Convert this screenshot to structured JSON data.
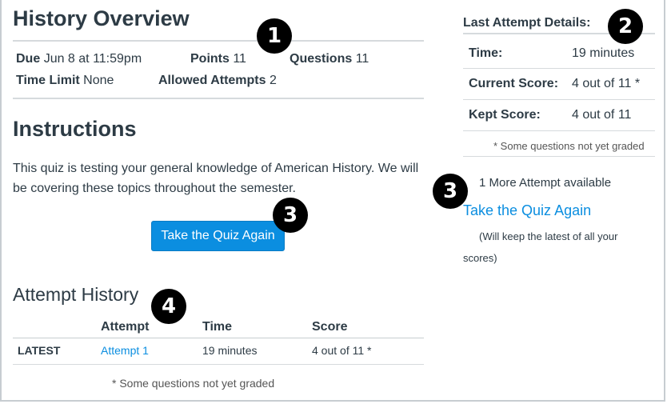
{
  "overview": {
    "title": "History Overview",
    "due_label": "Due",
    "due_value": "Jun 8 at 11:59pm",
    "points_label": "Points",
    "points_value": "11",
    "questions_label": "Questions",
    "questions_value": "11",
    "time_limit_label": "Time Limit",
    "time_limit_value": "None",
    "allowed_attempts_label": "Allowed Attempts",
    "allowed_attempts_value": "2"
  },
  "instructions": {
    "title": "Instructions",
    "text": "This quiz is testing your general knowledge of American History. We will be covering these topics throughout the semester.",
    "button_label": "Take the Quiz Again"
  },
  "attempt_history": {
    "title": "Attempt History",
    "columns": [
      "Attempt",
      "Time",
      "Score"
    ],
    "rows": [
      {
        "tag": "LATEST",
        "attempt": "Attempt 1",
        "time": "19 minutes",
        "score": "4 out of 11 *"
      }
    ],
    "footnote": "* Some questions not yet graded"
  },
  "sidebar": {
    "title": "Last Attempt Details:",
    "rows": [
      {
        "label": "Time:",
        "value": "19 minutes"
      },
      {
        "label": "Current Score:",
        "value": "4 out of 11 *"
      },
      {
        "label": "Kept Score:",
        "value": "4 out of 11"
      }
    ],
    "footnote": "* Some questions not yet graded",
    "more_attempts": "1 More Attempt available",
    "retake_link": "Take the Quiz Again",
    "keep_note": "(Will keep the latest of all your scores)"
  },
  "badges": [
    "1",
    "2",
    "3",
    "3",
    "4"
  ]
}
